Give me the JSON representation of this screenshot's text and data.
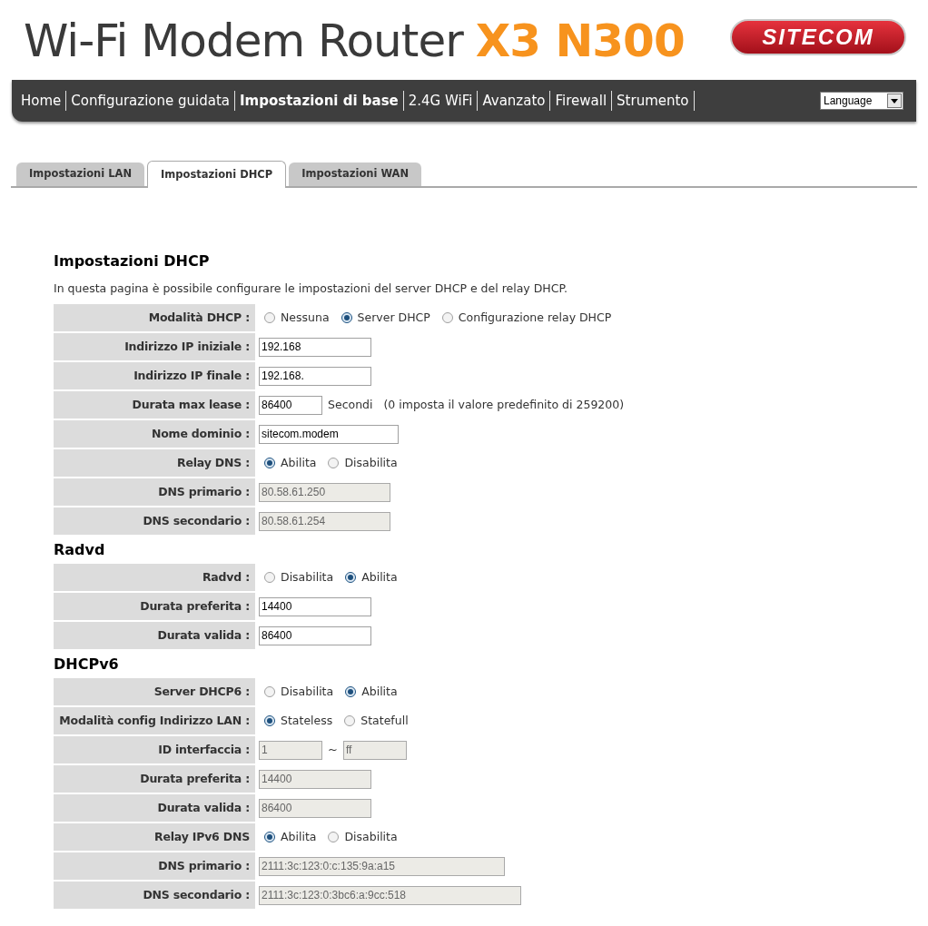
{
  "header": {
    "title": "Wi-Fi Modem Router",
    "model": "X3 N300",
    "logo": "SITECOM"
  },
  "nav": {
    "items": [
      {
        "label": "Home",
        "selected": false
      },
      {
        "label": "Configurazione guidata",
        "selected": false
      },
      {
        "label": "Impostazioni di base",
        "selected": true
      },
      {
        "label": "2.4G WiFi",
        "selected": false
      },
      {
        "label": "Avanzato",
        "selected": false
      },
      {
        "label": "Firewall",
        "selected": false
      },
      {
        "label": "Strumento",
        "selected": false
      }
    ],
    "language": "Language"
  },
  "tabs": [
    {
      "label": "Impostazioni LAN",
      "selected": false
    },
    {
      "label": "Impostazioni DHCP",
      "selected": true
    },
    {
      "label": "Impostazioni WAN",
      "selected": false
    }
  ],
  "sections": [
    {
      "title": "Impostazioni DHCP",
      "description": "In questa pagina è possibile configurare le impostazioni del server DHCP e del relay DHCP.",
      "rows": [
        {
          "label": "Modalità DHCP :",
          "kind": "radio",
          "options": [
            {
              "label": "Nessuna",
              "selected": false
            },
            {
              "label": "Server DHCP",
              "selected": true
            },
            {
              "label": "Configurazione relay DHCP",
              "selected": false
            }
          ]
        },
        {
          "label": "Indirizzo IP iniziale :",
          "kind": "input",
          "value": "192.168",
          "disabled": false
        },
        {
          "label": "Indirizzo IP finale :",
          "kind": "input",
          "value": "192.168.",
          "disabled": false
        },
        {
          "label": "Durata max lease :",
          "kind": "input_note",
          "value": "86400",
          "disabled": false,
          "unit": "Secondi",
          "note": "(0 imposta il valore predefinito di 259200)"
        },
        {
          "label": "Nome dominio :",
          "kind": "input",
          "value": "sitecom.modem",
          "disabled": false
        },
        {
          "label": "Relay DNS :",
          "kind": "radio",
          "options": [
            {
              "label": "Abilita",
              "selected": true
            },
            {
              "label": "Disabilita",
              "selected": false
            }
          ]
        },
        {
          "label": "DNS primario :",
          "kind": "input",
          "value": "80.58.61.250",
          "disabled": true
        },
        {
          "label": "DNS secondario :",
          "kind": "input",
          "value": "80.58.61.254",
          "disabled": true
        }
      ]
    },
    {
      "title": "Radvd",
      "rows": [
        {
          "label": "Radvd :",
          "kind": "radio",
          "options": [
            {
              "label": "Disabilita",
              "selected": false
            },
            {
              "label": "Abilita",
              "selected": true
            }
          ]
        },
        {
          "label": "Durata preferita :",
          "kind": "input",
          "value": "14400",
          "disabled": false
        },
        {
          "label": "Durata valida :",
          "kind": "input",
          "value": "86400",
          "disabled": false
        }
      ]
    },
    {
      "title": "DHCPv6",
      "rows": [
        {
          "label": "Server DHCP6 :",
          "kind": "radio",
          "options": [
            {
              "label": "Disabilita",
              "selected": false
            },
            {
              "label": "Abilita",
              "selected": true
            }
          ]
        },
        {
          "label": "Modalità config Indirizzo LAN :",
          "kind": "radio",
          "options": [
            {
              "label": "Stateless",
              "selected": true
            },
            {
              "label": "Statefull",
              "selected": false
            }
          ]
        },
        {
          "label": "ID interfaccia :",
          "kind": "range",
          "from": "1",
          "separator": "~",
          "to": "ff",
          "disabled": true
        },
        {
          "label": "Durata preferita :",
          "kind": "input",
          "value": "14400",
          "disabled": true
        },
        {
          "label": "Durata valida :",
          "kind": "input",
          "value": "86400",
          "disabled": true
        },
        {
          "label": "Relay IPv6 DNS",
          "kind": "radio",
          "options": [
            {
              "label": "Abilita",
              "selected": true
            },
            {
              "label": "Disabilita",
              "selected": false
            }
          ]
        },
        {
          "label": "DNS primario :",
          "kind": "input",
          "value": "2111:3c:123:0:c:135:9a:a15",
          "disabled": true
        },
        {
          "label": "DNS secondario :",
          "kind": "input",
          "value": "2111:3c:123:0:3bc6:a:9cc:518",
          "disabled": true
        }
      ]
    }
  ]
}
